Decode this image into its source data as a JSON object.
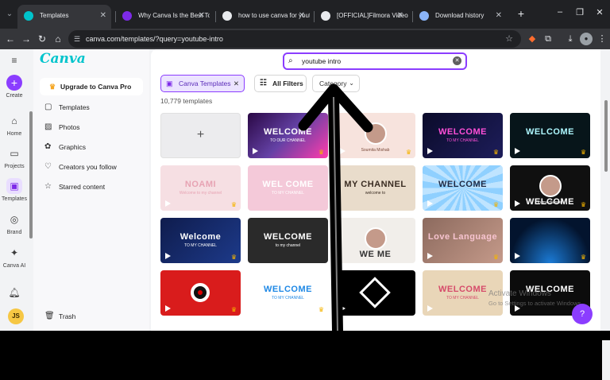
{
  "browser": {
    "tabs": [
      {
        "title": "Templates",
        "active": true,
        "favicon_color": "#00c4cc"
      },
      {
        "title": "Why Canva Is the Best Tool f",
        "active": false,
        "favicon_color": "#7d2ae8"
      },
      {
        "title": "how to use canva for youtub",
        "active": false,
        "favicon_color": "#e8eaed"
      },
      {
        "title": "[OFFICIAL]Filmora Video Edi",
        "active": false,
        "favicon_color": "#e8eaed"
      },
      {
        "title": "Download history",
        "active": false,
        "favicon_color": "#8ab4f8"
      }
    ],
    "url": "canva.com/templates/?query=youtube-intro"
  },
  "rail": {
    "create": "Create",
    "home": "Home",
    "projects": "Projects",
    "templates": "Templates",
    "brand": "Brand",
    "canva_ai": "Canva AI",
    "avatar_initials": "JS"
  },
  "sidebar": {
    "logo": "Canva",
    "upgrade": "Upgrade to Canva Pro",
    "items": [
      {
        "label": "Templates",
        "icon": "templates-icon"
      },
      {
        "label": "Photos",
        "icon": "photo-icon"
      },
      {
        "label": "Graphics",
        "icon": "graphics-icon"
      },
      {
        "label": "Creators you follow",
        "icon": "heart-icon"
      },
      {
        "label": "Starred content",
        "icon": "star-icon"
      }
    ],
    "trash": "Trash"
  },
  "main": {
    "search_value": "youtube intro",
    "chips": {
      "active": "Canva Templates",
      "filters": "All Filters",
      "category": "Category"
    },
    "result_count": "10,779 templates",
    "cards": [
      {
        "title": "",
        "bg": "#ececee",
        "blank": true
      },
      {
        "title": "WELCOME",
        "subtitle": "TO OUR CHANNEL",
        "bg": "linear-gradient(135deg,#2a0845,#6441a5 50%,#ff3cac)",
        "color": "#fff",
        "play": true,
        "crown": true
      },
      {
        "title": "",
        "subtitle": "Soumita Mishab",
        "bg": "#f7e3dd",
        "color": "#7a4a3a",
        "play": true,
        "crown": true,
        "circle": true
      },
      {
        "title": "WELCOME",
        "subtitle": "TO MY CHANNEL",
        "bg": "linear-gradient(135deg,#0b0b2a,#1d1d5a)",
        "color": "#ff4fd8",
        "play": true,
        "crown": true
      },
      {
        "title": "WELCOME",
        "subtitle": "",
        "bg": "#07151a",
        "color": "#aef8ff",
        "play": true,
        "crown": true
      },
      {
        "title": "NOAMI",
        "subtitle": "Welcome to my channel",
        "bg": "#f6dfe3",
        "color": "#e7a3b3",
        "play": true,
        "crown": true
      },
      {
        "title": "WEL COME",
        "subtitle": "TO MY CHANNEL",
        "bg": "#f4c9d9",
        "color": "#fff",
        "play": false,
        "crown": false
      },
      {
        "title": "MY CHANNEL",
        "subtitle": "welcome to",
        "bg": "#e9dccb",
        "color": "#3a2c22",
        "play": false,
        "crown": false
      },
      {
        "title": "WELCOME",
        "subtitle": "",
        "bg": "repeating-conic-gradient(#bfe4ff 0 10deg,#8fd0ff 10deg 20deg)",
        "color": "#1f2a44",
        "play": true,
        "crown": true
      },
      {
        "title": "WELCOME",
        "subtitle": "to my channel",
        "bg": "#101010",
        "color": "#fff",
        "play": true,
        "crown": true,
        "circle": true
      },
      {
        "title": "Welcome",
        "subtitle": "TO MY CHANNEL",
        "bg": "linear-gradient(135deg,#0f1c4d,#1d3a8a)",
        "color": "#fff",
        "play": true,
        "crown": true
      },
      {
        "title": "WELCOME",
        "subtitle": "to my channel",
        "bg": "#2a2a2a",
        "color": "#fff",
        "play": false,
        "crown": false
      },
      {
        "title": "WE    ME",
        "subtitle": "",
        "bg": "#f1eeea",
        "color": "#333",
        "play": false,
        "crown": false,
        "circle": true
      },
      {
        "title": "Love Language",
        "subtitle": "",
        "bg": "linear-gradient(135deg,#8c6a5e,#c59a8a)",
        "color": "#f7c4d0",
        "play": true,
        "crown": true
      },
      {
        "title": "",
        "subtitle": "",
        "bg": "radial-gradient(ellipse at 50% 100%,#1b7bd6,#03142e 70%)",
        "color": "#fff",
        "play": true,
        "crown": true
      },
      {
        "title": "",
        "subtitle": "",
        "bg": "#d91c1c",
        "color": "#fff",
        "play": true,
        "crown": true,
        "rec": true
      },
      {
        "title": "WELCOME",
        "subtitle": "TO MY CHANNEL",
        "bg": "#ffffff",
        "color": "#1e88e5",
        "play": true,
        "crown": true
      },
      {
        "title": "",
        "subtitle": "",
        "bg": "#000000",
        "color": "#fff",
        "play": true,
        "crown": false,
        "diamond": true
      },
      {
        "title": "WELCOME",
        "subtitle": "TO MY CHANNEL",
        "bg": "#e9d6b8",
        "color": "#d64b6a",
        "play": true,
        "crown": false
      },
      {
        "title": "WELCOME",
        "subtitle": "",
        "bg": "#0c0c0c",
        "color": "#fff",
        "play": true,
        "crown": false
      }
    ]
  },
  "watermark": {
    "line1": "Activate Windows",
    "line2": "Go to Settings to activate Windows."
  },
  "help": "?"
}
